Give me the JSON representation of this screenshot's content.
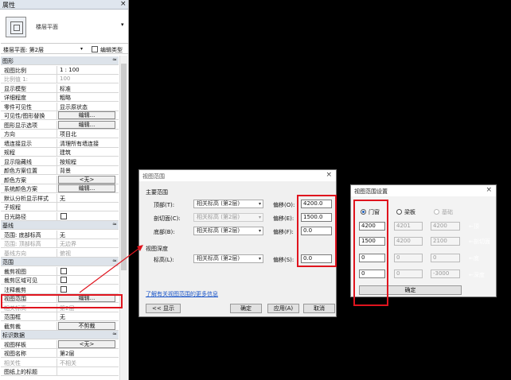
{
  "properties": {
    "title": "属性",
    "close": "×",
    "type_name": "楼层平面",
    "instance_label": "楼层平面: 第2层",
    "edit_type": "编辑类型",
    "rows": [
      {
        "kind": "cat",
        "k": "图形"
      },
      {
        "k": "视图比例",
        "v": "1 : 100"
      },
      {
        "k": "比例值 1:",
        "v": "100",
        "gray": true
      },
      {
        "k": "显示模型",
        "v": "标准"
      },
      {
        "k": "详细程度",
        "v": "粗略"
      },
      {
        "k": "零件可见性",
        "v": "显示原状态"
      },
      {
        "k": "可见性/图形替换",
        "btn": "编辑..."
      },
      {
        "k": "图形显示选项",
        "btn": "编辑..."
      },
      {
        "k": "方向",
        "v": "项目北"
      },
      {
        "k": "墙连接显示",
        "v": "清理所有墙连接"
      },
      {
        "k": "规程",
        "v": "建筑"
      },
      {
        "k": "显示隐藏线",
        "v": "按规程"
      },
      {
        "k": "颜色方案位置",
        "v": "背景"
      },
      {
        "k": "颜色方案",
        "btn": "<无>"
      },
      {
        "k": "系统颜色方案",
        "btn": "编辑..."
      },
      {
        "k": "默认分析显示样式",
        "v": "无"
      },
      {
        "k": "子规程",
        "v": ""
      },
      {
        "k": "日光路径",
        "check": true
      },
      {
        "kind": "cat",
        "k": "基线"
      },
      {
        "k": "范围: 底部标高",
        "v": "无"
      },
      {
        "k": "范围: 顶部标高",
        "v": "无边界",
        "gray": true
      },
      {
        "k": "基线方向",
        "v": "俯视",
        "gray": true
      },
      {
        "kind": "cat",
        "k": "范围"
      },
      {
        "k": "裁剪视图",
        "check": true
      },
      {
        "k": "裁剪区域可见",
        "check": true
      },
      {
        "k": "注释裁剪",
        "check": true
      },
      {
        "k": "视图范围",
        "btn": "编辑..."
      },
      {
        "k": "相关标高",
        "v": "第2层",
        "gray": true
      },
      {
        "k": "范围框",
        "v": "无"
      },
      {
        "k": "截剪裁",
        "btn": "不剪裁"
      },
      {
        "kind": "cat",
        "k": "标识数据"
      },
      {
        "k": "视图样板",
        "btn": "<无>"
      },
      {
        "k": "视图名称",
        "v": "第2层"
      },
      {
        "k": "相关性",
        "v": "不相关",
        "gray": true
      },
      {
        "k": "图纸上的标题",
        "v": ""
      }
    ]
  },
  "view_range": {
    "title": "视图范围",
    "main_range": "主要范围",
    "top_label": "顶部(T):",
    "cut_label": "剖切面(C):",
    "bottom_label": "底部(B):",
    "view_depth": "视图深度",
    "level_label": "标高(L):",
    "assoc_level": "相关标高 (第2层)",
    "offset_o": "偏移(O):",
    "offset_e": "偏移(E):",
    "offset_f": "偏移(F):",
    "offset_s": "偏移(S):",
    "top_offset": "4200.0",
    "cut_offset": "1500.0",
    "bottom_offset": "0.0",
    "depth_offset": "0.0",
    "help_link": "了解有关视图范围的更多信息",
    "show_btn": "<< 显示",
    "ok": "确定",
    "apply": "应用(A)",
    "cancel": "取消"
  },
  "crop_settings": {
    "title": "视图范围设置",
    "opt_door": "门窗",
    "opt_beam": "梁板",
    "opt_base": "基础",
    "col1": [
      "4200",
      "1500",
      "0",
      "0"
    ],
    "col2": [
      "4201",
      "4200",
      "0",
      "0"
    ],
    "col3": [
      "4200",
      "2100",
      "0",
      "-3000"
    ],
    "ann": [
      "←顶",
      "←剖切面",
      "←底",
      "←深度"
    ],
    "ok": "确定"
  }
}
